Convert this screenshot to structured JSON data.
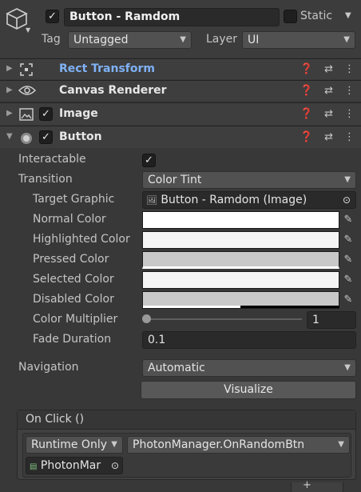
{
  "gameobject": {
    "name": "Button - Ramdom",
    "active_checked": "✓",
    "static_label": "Static",
    "tag_label": "Tag",
    "tag_value": "Untagged",
    "layer_label": "Layer",
    "layer_value": "UI"
  },
  "components": {
    "rect_transform": "Rect Transform",
    "canvas_renderer": "Canvas Renderer",
    "image": "Image",
    "button": "Button"
  },
  "button": {
    "interactable_label": "Interactable",
    "interactable_check": "✓",
    "transition_label": "Transition",
    "transition_value": "Color Tint",
    "target_graphic_label": "Target Graphic",
    "target_graphic_value": "Button - Ramdom (Image)",
    "normal_color_label": "Normal Color",
    "highlighted_color_label": "Highlighted Color",
    "pressed_color_label": "Pressed Color",
    "selected_color_label": "Selected Color",
    "disabled_color_label": "Disabled Color",
    "color_multiplier_label": "Color Multiplier",
    "color_multiplier_value": "1",
    "color_multiplier_fraction": 0.0,
    "fade_duration_label": "Fade Duration",
    "fade_duration_value": "0.1",
    "navigation_label": "Navigation",
    "navigation_value": "Automatic",
    "visualize_label": "Visualize"
  },
  "colors": {
    "normal": "#ffffff",
    "highlighted": "#f5f5f5",
    "pressed": "#c8c8c8",
    "selected": "#f5f5f5",
    "disabled": "#c8c8c8",
    "accent_link": "#7fb1f5"
  },
  "on_click": {
    "header": "On Click ()",
    "runtime_value": "Runtime Only",
    "function_value": "PhotonManager.OnRandomBtn",
    "object_value": "PhotonMar"
  }
}
